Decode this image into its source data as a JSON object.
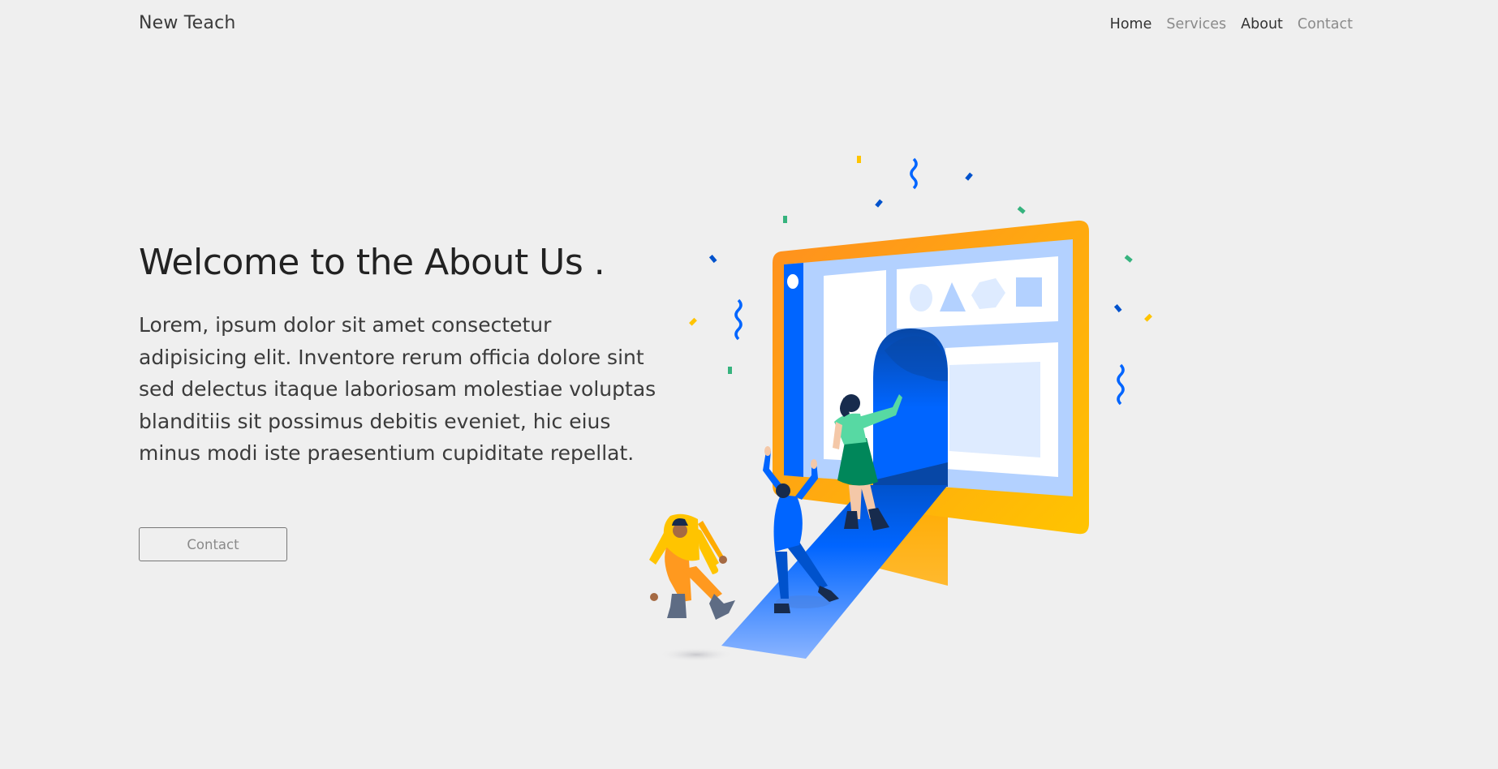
{
  "navbar": {
    "brand": "New Teach",
    "links": [
      {
        "label": "Home",
        "active": true
      },
      {
        "label": "Services",
        "active": false
      },
      {
        "label": "About",
        "active": true
      },
      {
        "label": "Contact",
        "active": false
      }
    ]
  },
  "hero": {
    "title": "Welcome to the About Us .",
    "text": "Lorem, ipsum dolor sit amet consectetur adipisicing elit. Inventore rerum officia dolore sint sed delectus itaque laboriosam molestiae voluptas blanditiis sit possimus debitis eveniet, hic eius minus modi iste praesentium cupiditate repellat.",
    "button_label": "Contact"
  },
  "illustration": {
    "icon": "people-entering-computer-screen-illustration",
    "colors": {
      "monitor_orange": "#ffb400",
      "screen_blue": "#0065ff",
      "screen_light": "#b3d1ff",
      "confetti_green": "#36b37e",
      "confetti_yellow": "#ffc400"
    }
  }
}
